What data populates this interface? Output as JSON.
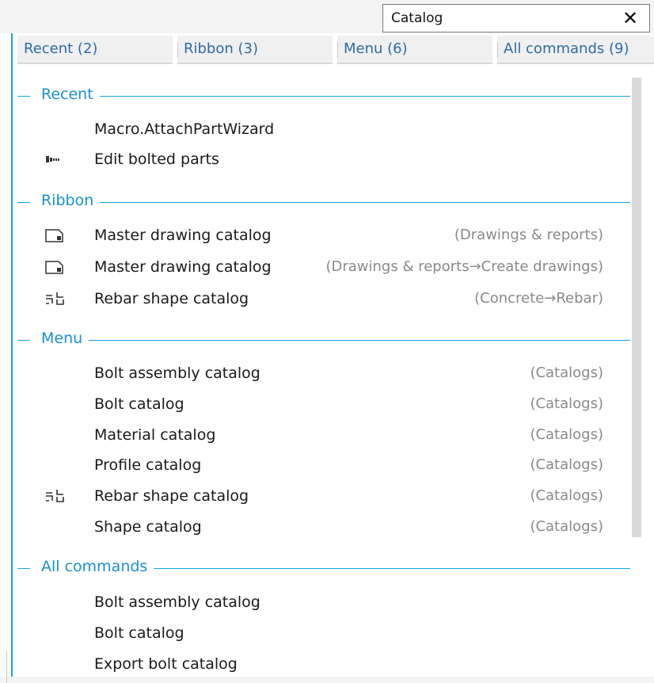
{
  "search": {
    "value": "Catalog",
    "clear_label": "✕"
  },
  "tabs": [
    {
      "label": "Recent (2)"
    },
    {
      "label": "Ribbon (3)"
    },
    {
      "label": "Menu (6)"
    },
    {
      "label": "All commands (9)"
    }
  ],
  "sections": {
    "recent": {
      "title": "Recent",
      "items": [
        {
          "label": "Macro.AttachPartWizard",
          "path": "",
          "icon": "none"
        },
        {
          "label": "Edit bolted parts",
          "path": "",
          "icon": "bolt-icon"
        }
      ]
    },
    "ribbon": {
      "title": "Ribbon",
      "items": [
        {
          "label": "Master drawing catalog",
          "path": "(Drawings & reports)",
          "icon": "drawing-catalog-icon"
        },
        {
          "label": "Master drawing catalog",
          "path": "(Drawings & reports→Create drawings)",
          "icon": "drawing-catalog-icon"
        },
        {
          "label": "Rebar shape catalog",
          "path": "(Concrete→Rebar)",
          "icon": "rebar-shape-icon"
        }
      ]
    },
    "menu": {
      "title": "Menu",
      "items": [
        {
          "label": "Bolt assembly catalog",
          "path": "(Catalogs)",
          "icon": "none"
        },
        {
          "label": "Bolt catalog",
          "path": "(Catalogs)",
          "icon": "none"
        },
        {
          "label": "Material catalog",
          "path": "(Catalogs)",
          "icon": "none"
        },
        {
          "label": "Profile catalog",
          "path": "(Catalogs)",
          "icon": "none"
        },
        {
          "label": "Rebar shape catalog",
          "path": "(Catalogs)",
          "icon": "rebar-shape-icon"
        },
        {
          "label": "Shape catalog",
          "path": "(Catalogs)",
          "icon": "none"
        }
      ]
    },
    "all": {
      "title": "All commands",
      "items": [
        {
          "label": "Bolt assembly catalog",
          "path": "",
          "icon": "none"
        },
        {
          "label": "Bolt catalog",
          "path": "",
          "icon": "none"
        },
        {
          "label": "Export bolt catalog",
          "path": "",
          "icon": "none"
        }
      ]
    }
  },
  "colors": {
    "accent": "#1aa3e0",
    "section_title": "#1a90d0",
    "tab_text": "#2d6ca6",
    "path_text": "#8a8a8a"
  }
}
